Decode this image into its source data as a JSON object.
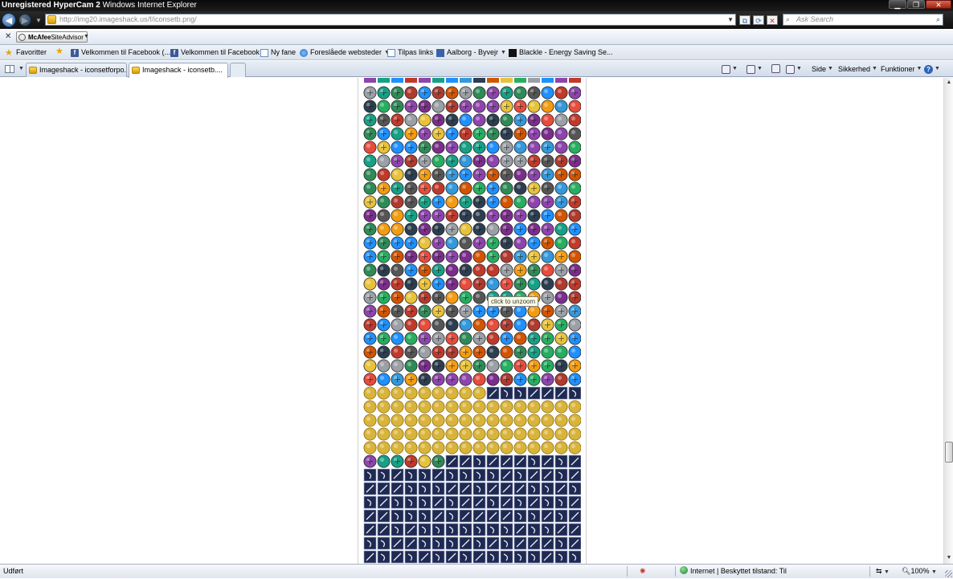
{
  "window": {
    "hypercam_text": "Unregistered HyperCam 2",
    "browser_title": "Windows Internet Explorer",
    "controls": {
      "minimize": "▁",
      "maximize": "❐",
      "close": "✕"
    }
  },
  "address_bar": {
    "url": "http://img20.imageshack.us/f/iconsetb.png/",
    "search_placeholder": "Ask Search",
    "buttons": {
      "back": "◀",
      "forward": "▶",
      "compat": "⧉",
      "refresh": "⟳",
      "stop": "✕"
    }
  },
  "addon_bar": {
    "close": "✕",
    "mcafee_brand": "McAfee",
    "mcafee_product": "SiteAdvisor"
  },
  "favorites_bar": {
    "favorites_label": "Favoritter",
    "items": [
      {
        "label": "Velkommen til Facebook (...",
        "icon": "facebook-icon"
      },
      {
        "label": "Velkommen til Facebook",
        "icon": "facebook-icon"
      },
      {
        "label": "Ny fane",
        "icon": "page-icon"
      },
      {
        "label": "Foreslåede websteder",
        "icon": "ie-icon"
      },
      {
        "label": "Tilpas links",
        "icon": "page-icon"
      },
      {
        "label": "Aalborg - Byvejr",
        "icon": "map-icon"
      },
      {
        "label": "Blackle - Energy Saving Se...",
        "icon": "blackle-icon"
      }
    ]
  },
  "tabs": {
    "items": [
      {
        "label": "Imageshack - iconsetforpo...",
        "active": false
      },
      {
        "label": "Imageshack - iconsetb....",
        "active": true
      }
    ]
  },
  "command_bar": {
    "side": "Side",
    "sikkerhed": "Sikkerhed",
    "funktioner": "Funktioner"
  },
  "page": {
    "tooltip": "click to unzoom",
    "palette": [
      "#7b2d8b",
      "#1e90ff",
      "#2e8b57",
      "#c0392b",
      "#e8c23a",
      "#555555",
      "#d35400",
      "#8e44ad",
      "#16a085",
      "#2c3e50",
      "#9aa0a6",
      "#e74c3c",
      "#27ae60",
      "#f39c12",
      "#3498db",
      "#b03a2e"
    ],
    "coin_color": "#d9b43a",
    "tile_color": "#1f2a52"
  },
  "status_bar": {
    "status": "Udført",
    "zone": "Internet | Beskyttet tilstand: Til",
    "zoom": "100%"
  }
}
